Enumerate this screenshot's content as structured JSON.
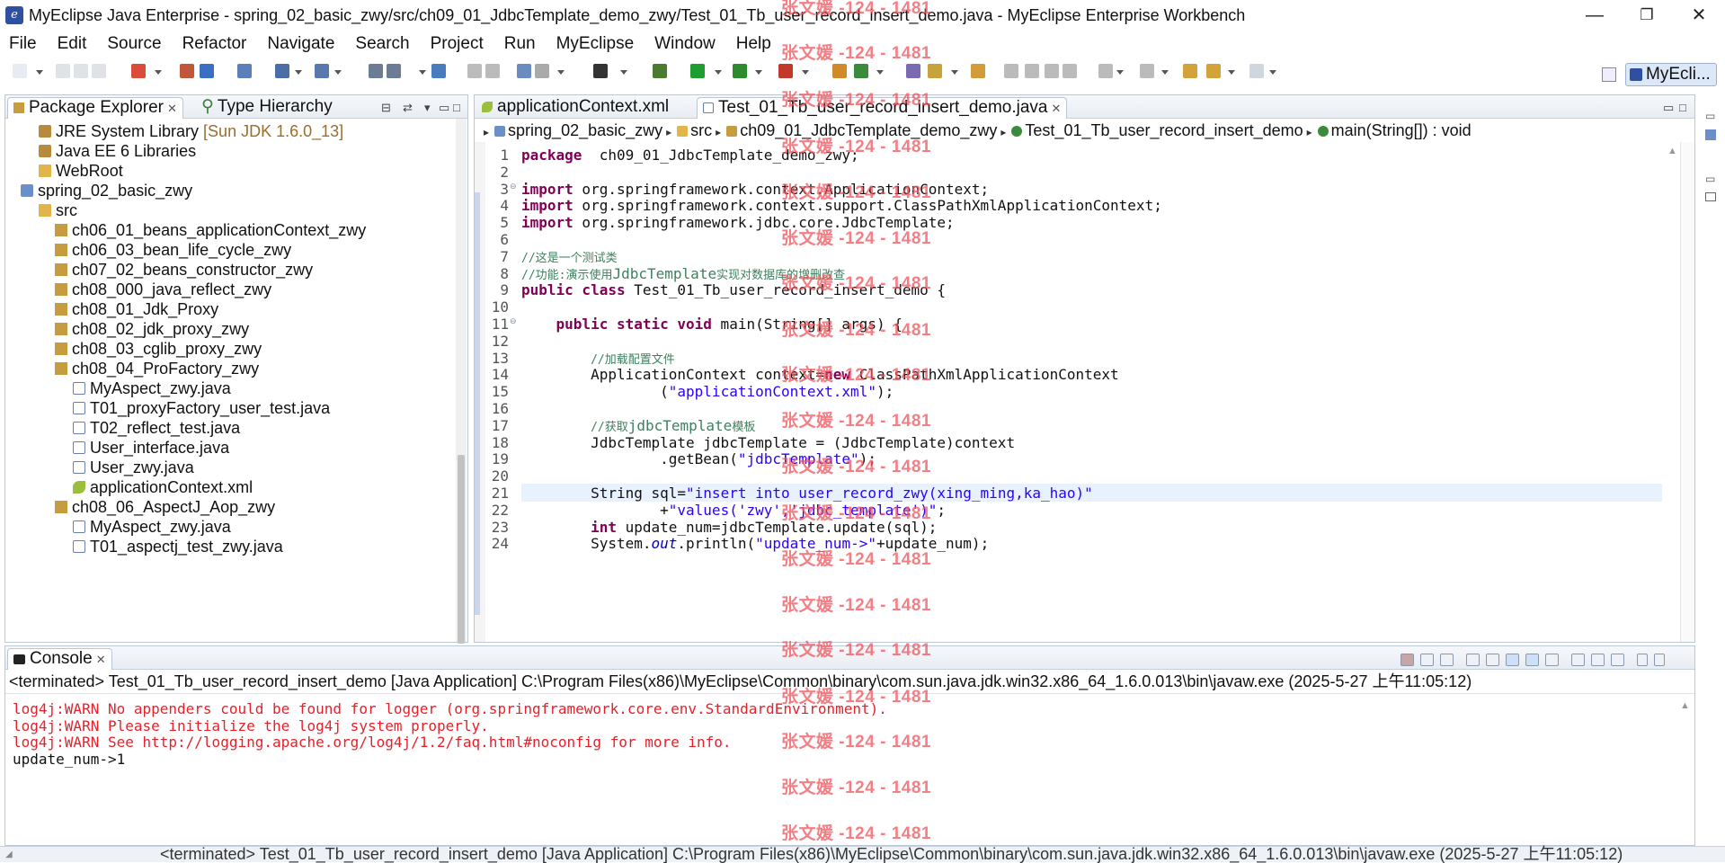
{
  "window": {
    "title": "MyEclipse Java Enterprise - spring_02_basic_zwy/src/ch09_01_JdbcTemplate_demo_zwy/Test_01_Tb_user_record_insert_demo.java - MyEclipse Enterprise Workbench",
    "app_icon": "myeclipse-icon",
    "minimize": "—",
    "maximize": "❐",
    "close": "✕"
  },
  "menu": [
    "File",
    "Edit",
    "Source",
    "Refactor",
    "Navigate",
    "Search",
    "Project",
    "Run",
    "MyEclipse",
    "Window",
    "Help"
  ],
  "perspective": {
    "label": "MyEcli..."
  },
  "explorer": {
    "tabs": [
      {
        "label": "Package Explorer"
      },
      {
        "label": "Type Hierarchy"
      }
    ],
    "tree": [
      {
        "indent": 0,
        "icon": "jar",
        "label": "JRE System Library",
        "suffix": " [Sun JDK 1.6.0_13]"
      },
      {
        "indent": 0,
        "icon": "jar",
        "label": "Java EE 6 Libraries",
        "suffix": ""
      },
      {
        "indent": 0,
        "icon": "folder",
        "label": "WebRoot",
        "suffix": ""
      },
      {
        "indent": -1,
        "icon": "proj",
        "label": "spring_02_basic_zwy",
        "suffix": ""
      },
      {
        "indent": 0,
        "icon": "folder",
        "label": "src",
        "suffix": ""
      },
      {
        "indent": 1,
        "icon": "pkg",
        "label": "ch06_01_beans_applicationContext_zwy",
        "suffix": ""
      },
      {
        "indent": 1,
        "icon": "pkg",
        "label": "ch06_03_bean_life_cycle_zwy",
        "suffix": ""
      },
      {
        "indent": 1,
        "icon": "pkg",
        "label": "ch07_02_beans_constructor_zwy",
        "suffix": ""
      },
      {
        "indent": 1,
        "icon": "pkg",
        "label": "ch08_000_java_reflect_zwy",
        "suffix": ""
      },
      {
        "indent": 1,
        "icon": "pkg",
        "label": "ch08_01_Jdk_Proxy",
        "suffix": ""
      },
      {
        "indent": 1,
        "icon": "pkg",
        "label": "ch08_02_jdk_proxy_zwy",
        "suffix": ""
      },
      {
        "indent": 1,
        "icon": "pkg",
        "label": "ch08_03_cglib_proxy_zwy",
        "suffix": ""
      },
      {
        "indent": 1,
        "icon": "pkg",
        "label": "ch08_04_ProFactory_zwy",
        "suffix": ""
      },
      {
        "indent": 2,
        "icon": "java",
        "label": "MyAspect_zwy.java",
        "suffix": ""
      },
      {
        "indent": 2,
        "icon": "java",
        "label": "T01_proxyFactory_user_test.java",
        "suffix": ""
      },
      {
        "indent": 2,
        "icon": "java",
        "label": "T02_reflect_test.java",
        "suffix": ""
      },
      {
        "indent": 2,
        "icon": "java",
        "label": "User_interface.java",
        "suffix": ""
      },
      {
        "indent": 2,
        "icon": "java",
        "label": "User_zwy.java",
        "suffix": ""
      },
      {
        "indent": 2,
        "icon": "xml",
        "label": "applicationContext.xml",
        "suffix": ""
      },
      {
        "indent": 1,
        "icon": "pkg",
        "label": "ch08_06_AspectJ_Aop_zwy",
        "suffix": ""
      },
      {
        "indent": 2,
        "icon": "java",
        "label": "MyAspect_zwy.java",
        "suffix": ""
      },
      {
        "indent": 2,
        "icon": "java",
        "label": "T01_aspectj_test_zwy.java",
        "suffix": ""
      }
    ]
  },
  "editor": {
    "tabs": [
      {
        "label": "applicationContext.xml",
        "active": false
      },
      {
        "label": "Test_01_Tb_user_record_insert_demo.java",
        "active": true
      }
    ],
    "breadcrumb": [
      "spring_02_basic_zwy",
      "src",
      "ch09_01_JdbcTemplate_demo_zwy",
      "Test_01_Tb_user_record_insert_demo",
      "main(String[]) : void"
    ],
    "highlight_line": 21,
    "lines": [
      {
        "n": "1",
        "parts": [
          [
            "kw",
            "package"
          ],
          [
            "",
            "  ch09_01_JdbcTemplate_demo_zwy;"
          ]
        ]
      },
      {
        "n": "2",
        "parts": []
      },
      {
        "n": "3",
        "parts": [
          [
            "kw",
            "import"
          ],
          [
            "",
            " org.springframework.context.ApplicationContext;"
          ]
        ]
      },
      {
        "n": "4",
        "parts": [
          [
            "kw",
            "import"
          ],
          [
            "",
            " org.springframework.context.support.ClassPathXmlApplicationContext;"
          ]
        ]
      },
      {
        "n": "5",
        "parts": [
          [
            "kw",
            "import"
          ],
          [
            "",
            " org.springframework.jdbc.core.JdbcTemplate;"
          ]
        ]
      },
      {
        "n": "6",
        "parts": []
      },
      {
        "n": "7",
        "parts": [
          [
            "cm",
            "//这是一个测试类"
          ]
        ]
      },
      {
        "n": "8",
        "parts": [
          [
            "cm",
            "//功能:演示使用"
          ],
          [
            "cmj",
            "JdbcTemplate"
          ],
          [
            "cm",
            "实现对数据库的增删改查"
          ]
        ]
      },
      {
        "n": "9",
        "parts": [
          [
            "kw",
            "public class"
          ],
          [
            "",
            " Test_01_Tb_user_record_insert_demo {"
          ]
        ]
      },
      {
        "n": "10",
        "parts": []
      },
      {
        "n": "11",
        "parts": [
          [
            "",
            "    "
          ],
          [
            "kw",
            "public static void"
          ],
          [
            "",
            " main(String[] args) {"
          ]
        ]
      },
      {
        "n": "12",
        "parts": []
      },
      {
        "n": "13",
        "parts": [
          [
            "",
            "        "
          ],
          [
            "cm",
            "//加载配置文件"
          ]
        ]
      },
      {
        "n": "14",
        "parts": [
          [
            "",
            "        ApplicationContext context="
          ],
          [
            "kw",
            "new"
          ],
          [
            "",
            " ClassPathXmlApplicationContext"
          ]
        ]
      },
      {
        "n": "15",
        "parts": [
          [
            "",
            "                ("
          ],
          [
            "str",
            "\"applicationContext.xml\""
          ],
          [
            "",
            ");"
          ]
        ]
      },
      {
        "n": "16",
        "parts": []
      },
      {
        "n": "17",
        "parts": [
          [
            "",
            "        "
          ],
          [
            "cm",
            "//获取"
          ],
          [
            "cmj",
            "jdbcTemplate"
          ],
          [
            "cm",
            "模板"
          ]
        ]
      },
      {
        "n": "18",
        "parts": [
          [
            "",
            "        JdbcTemplate jdbcTemplate = (JdbcTemplate)context"
          ]
        ]
      },
      {
        "n": "19",
        "parts": [
          [
            "",
            "                .getBean("
          ],
          [
            "str",
            "\"jdbcTemplate\""
          ],
          [
            "",
            ");"
          ]
        ]
      },
      {
        "n": "20",
        "parts": []
      },
      {
        "n": "21",
        "parts": [
          [
            "",
            "        String sql="
          ],
          [
            "str",
            "\"insert into user_record_zwy(xing_ming,ka_hao)\""
          ]
        ]
      },
      {
        "n": "22",
        "parts": [
          [
            "",
            "                +"
          ],
          [
            "str",
            "\"values('zwy','jdbc_template')\""
          ],
          [
            "",
            ";"
          ]
        ]
      },
      {
        "n": "23",
        "parts": [
          [
            "",
            "        "
          ],
          [
            "kw",
            "int"
          ],
          [
            "",
            " update_num=jdbcTemplate.update(sql);"
          ]
        ]
      },
      {
        "n": "24",
        "parts": [
          [
            "",
            "        System."
          ],
          [
            "it",
            "out"
          ],
          [
            "",
            ".println("
          ],
          [
            "str",
            "\"update_num->\""
          ],
          [
            "",
            "+update_num);"
          ]
        ]
      }
    ]
  },
  "console": {
    "tab_label": "Console",
    "header": "<terminated> Test_01_Tb_user_record_insert_demo [Java Application] C:\\Program Files(x86)\\MyEclipse\\Common\\binary\\com.sun.java.jdk.win32.x86_64_1.6.0.013\\bin\\javaw.exe (2025-5-27 上午11:05:12)",
    "lines": [
      {
        "kind": "err",
        "text": "log4j:WARN No appenders could be found for logger (org.springframework.core.env.StandardEnvironment)."
      },
      {
        "kind": "err",
        "text": "log4j:WARN Please initialize the log4j system properly."
      },
      {
        "kind": "err",
        "text": "log4j:WARN See http://logging.apache.org/log4j/1.2/faq.html#noconfig for more info."
      },
      {
        "kind": "out",
        "text": "update_num->1"
      }
    ]
  },
  "statusbar": {
    "text": "<terminated> Test_01_Tb_user_record_insert_demo [Java Application] C:\\Program Files(x86)\\MyEclipse\\Common\\binary\\com.sun.java.jdk.win32.x86_64_1.6.0.013\\bin\\javaw.exe (2025-5-27 上午11:05:12)"
  },
  "watermark": {
    "text": "张文媛 -124 - 1481"
  }
}
